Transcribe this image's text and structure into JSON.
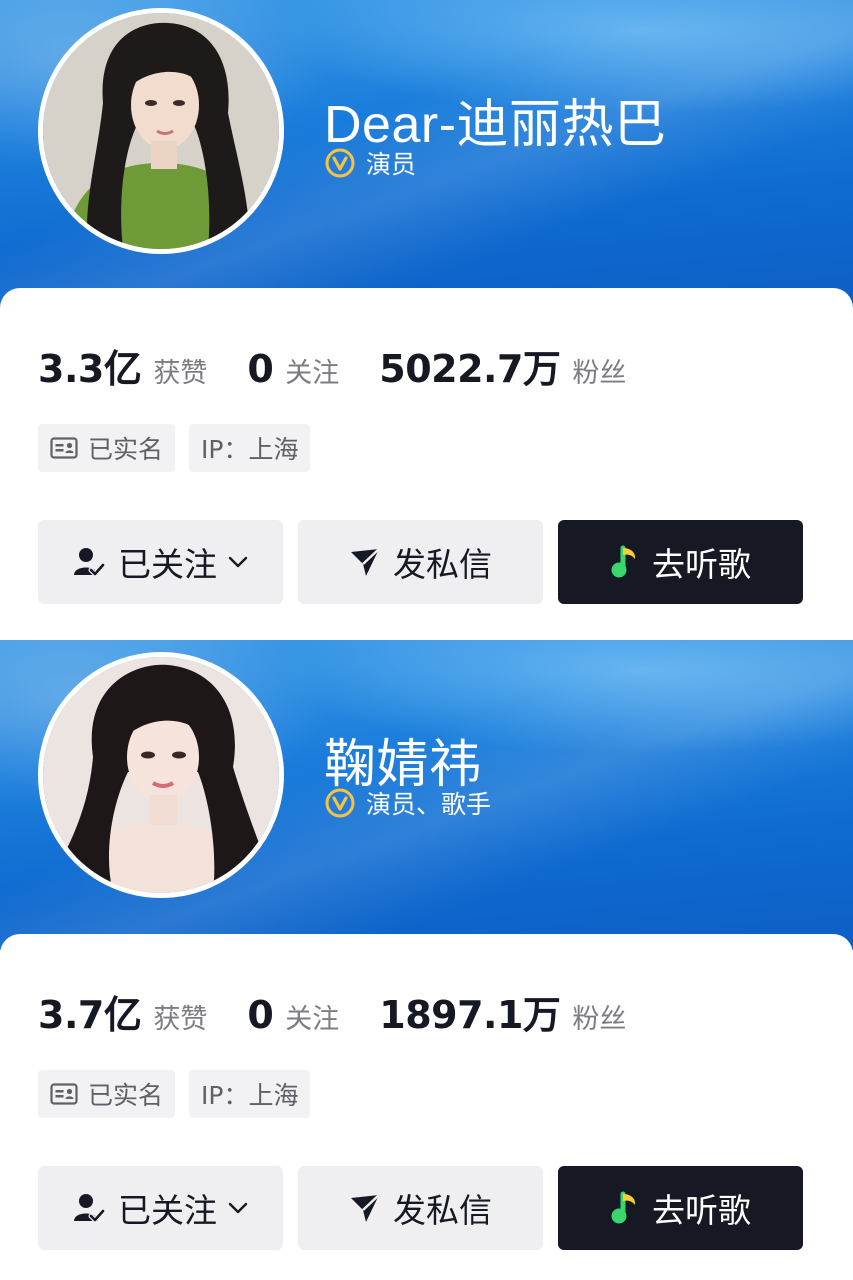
{
  "profiles": [
    {
      "name": "Dear-迪丽热巴",
      "certification": "演员",
      "stats": {
        "likes_value": "3.3亿",
        "likes_label": "获赞",
        "following_value": "0",
        "following_label": "关注",
        "followers_value": "5022.7万",
        "followers_label": "粉丝"
      },
      "tags": {
        "verified": "已实名",
        "ip": "IP：上海"
      },
      "buttons": {
        "follow": "已关注",
        "message": "发私信",
        "music": "去听歌"
      },
      "avatar": {
        "top_color": "#6f9a38",
        "bg_color": "#d8d4cc"
      }
    },
    {
      "name": "鞠婧祎",
      "certification": "演员、歌手",
      "stats": {
        "likes_value": "3.7亿",
        "likes_label": "获赞",
        "following_value": "0",
        "following_label": "关注",
        "followers_value": "1897.1万",
        "followers_label": "粉丝"
      },
      "tags": {
        "verified": "已实名",
        "ip": "IP：上海"
      },
      "buttons": {
        "follow": "已关注",
        "message": "发私信",
        "music": "去听歌"
      },
      "avatar": {
        "top_color": "#f2e6e0",
        "bg_color": "#ece4e0"
      }
    }
  ],
  "colors": {
    "banner_blue": "#1c7fdc",
    "verified_gold": "#f5c344",
    "dark_button": "#161823",
    "music_green": "#38d66b"
  },
  "icons": [
    "verified-v-icon",
    "id-card-icon",
    "person-check-icon",
    "chevron-down-icon",
    "send-icon",
    "music-note-icon"
  ]
}
